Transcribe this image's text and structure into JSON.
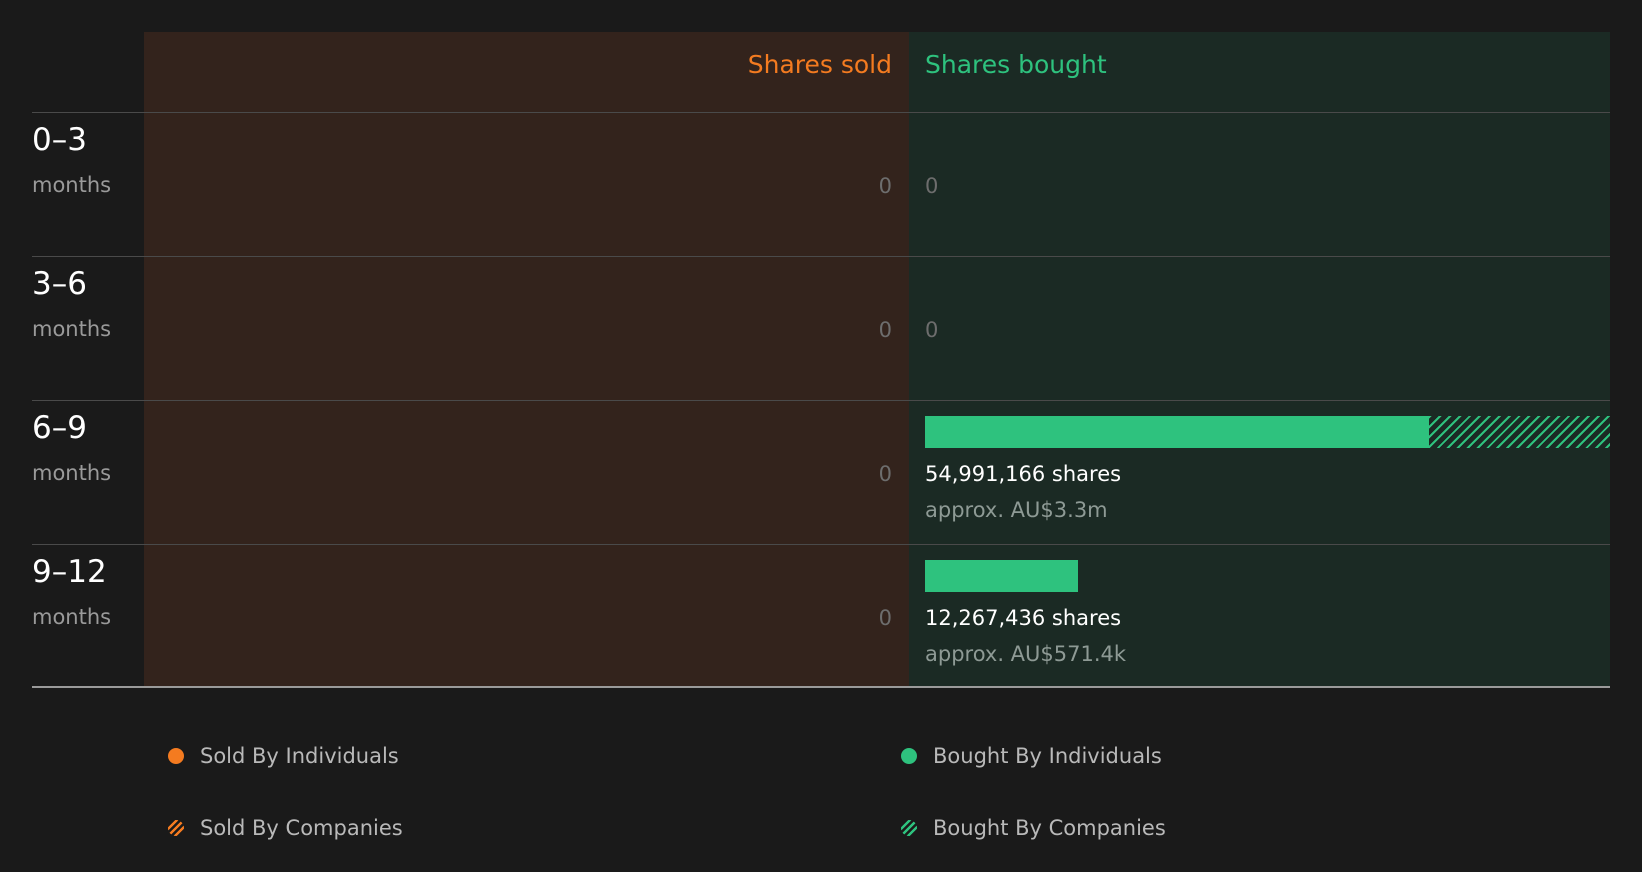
{
  "colors": {
    "sold": "#f47b20",
    "bought": "#2ec27e",
    "sold_bg": "#33231c",
    "bought_bg": "#1b2a24"
  },
  "chart_data": {
    "type": "bar",
    "orientation": "horizontal",
    "headers": {
      "sold": "Shares sold",
      "bought": "Shares bought"
    },
    "unit_label": "months",
    "categories": [
      "0–3",
      "3–6",
      "6–9",
      "9–12"
    ],
    "series": [
      {
        "name": "Sold By Individuals",
        "values": [
          0,
          0,
          0,
          0
        ]
      },
      {
        "name": "Sold By Companies",
        "values": [
          0,
          0,
          0,
          0
        ]
      },
      {
        "name": "Bought By Individuals",
        "values": [
          0,
          0,
          40500000,
          12267436
        ]
      },
      {
        "name": "Bought By Companies",
        "values": [
          0,
          0,
          14491166,
          0
        ]
      }
    ],
    "totals": {
      "sold": [
        "0",
        "0",
        "0",
        "0"
      ],
      "bought": [
        "0",
        "0",
        "54,991,166 shares",
        "12,267,436 shares"
      ],
      "bought_value": [
        "",
        "",
        "approx. AU$3.3m",
        "approx. AU$571.4k"
      ]
    },
    "xlim": [
      0,
      54991166
    ],
    "legend": [
      {
        "label": "Sold By Individuals",
        "style": "solid",
        "color": "#f47b20"
      },
      {
        "label": "Bought By Individuals",
        "style": "solid",
        "color": "#2ec27e"
      },
      {
        "label": "Sold By Companies",
        "style": "hatched",
        "color": "#f47b20"
      },
      {
        "label": "Bought By Companies",
        "style": "hatched",
        "color": "#2ec27e"
      }
    ]
  }
}
